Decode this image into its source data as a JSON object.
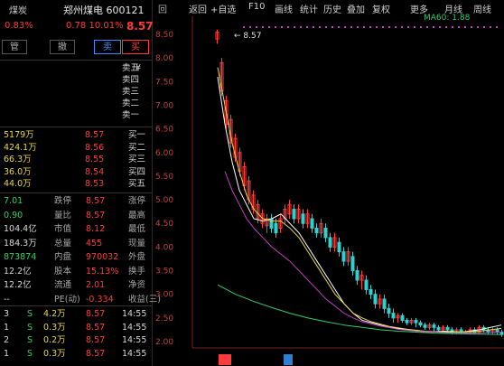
{
  "toolbar": {
    "items": [
      "周线",
      "月线",
      "更多",
      "复权",
      "叠加",
      "历史",
      "统计",
      "画线",
      "F10",
      "+自选",
      "返回"
    ],
    "badge": "回"
  },
  "quote": {
    "name_code": "郑州煤电 600121",
    "market": "煤炭",
    "price": "8.57",
    "change": "0.78",
    "change_pct": "10.01%",
    "ratio": "0.83%",
    "buttons": {
      "buy": "买",
      "sell": "卖",
      "cancel": "撤",
      "position": "管"
    }
  },
  "asks": [
    {
      "label": "卖五",
      "price": "¥",
      "vol": ""
    },
    {
      "label": "卖四",
      "price": "",
      "vol": ""
    },
    {
      "label": "卖三",
      "price": "",
      "vol": ""
    },
    {
      "label": "卖二",
      "price": "",
      "vol": ""
    },
    {
      "label": "卖一",
      "price": "",
      "vol": ""
    }
  ],
  "bids": [
    {
      "label": "买一",
      "price": "8.57",
      "vol": "5179万"
    },
    {
      "label": "买二",
      "price": "8.56",
      "vol": "424.1万"
    },
    {
      "label": "买三",
      "price": "8.55",
      "vol": "66.3万"
    },
    {
      "label": "买四",
      "price": "8.54",
      "vol": "36.0万"
    },
    {
      "label": "买五",
      "price": "8.53",
      "vol": "44.0万"
    }
  ],
  "stats": [
    {
      "l1": "涨停",
      "v1": "8.57",
      "l2": "跌停",
      "v2": "7.01"
    },
    {
      "l1": "最高",
      "v1": "8.57",
      "l2": "量比",
      "v2": "0.90"
    },
    {
      "l1": "最低",
      "v1": "8.12",
      "l2": "市值",
      "v2": "104.4亿"
    },
    {
      "l1": "现量",
      "v1": "455",
      "l2": "总量",
      "v2": "184.3万"
    },
    {
      "l1": "外盘",
      "v1": "970032",
      "l2": "内盘",
      "v2": "873874"
    },
    {
      "l1": "换手",
      "v1": "15.13%",
      "l2": "股本",
      "v2": "12.2亿"
    },
    {
      "l1": "净资",
      "v1": "2.01",
      "l2": "流通",
      "v2": "12.2亿"
    },
    {
      "l1": "收益(三)",
      "v1": "-0.334",
      "l2": "PE(动)",
      "v2": "--"
    }
  ],
  "ticks": [
    {
      "time": "14:55",
      "price": "8.57",
      "vol": "4.2万",
      "dir": "S",
      "n": "3"
    },
    {
      "time": "14:55",
      "price": "8.57",
      "vol": "0.3万",
      "dir": "S",
      "n": "1"
    },
    {
      "time": "14:55",
      "price": "8.57",
      "vol": "0.2万",
      "dir": "S",
      "n": "2"
    },
    {
      "time": "14:55",
      "price": "8.57",
      "vol": "0.3万",
      "dir": "S",
      "n": "1"
    }
  ],
  "chart": {
    "ma_label": "MA60: 1.88",
    "high_label": "8.57",
    "y_ticks": [
      "8.50",
      "8.00",
      "7.50",
      "7.00",
      "6.50",
      "6.00",
      "5.50",
      "5.00",
      "4.50",
      "4.00",
      "3.50",
      "3.00",
      "2.50",
      "2.00"
    ],
    "colors": {
      "up": "#ff3b3b",
      "down": "#2fd0d0",
      "ma5": "#ffffff",
      "ma10": "#e6d64a",
      "ma20": "#c040c0",
      "ma60": "#2fcf6a"
    }
  }
}
